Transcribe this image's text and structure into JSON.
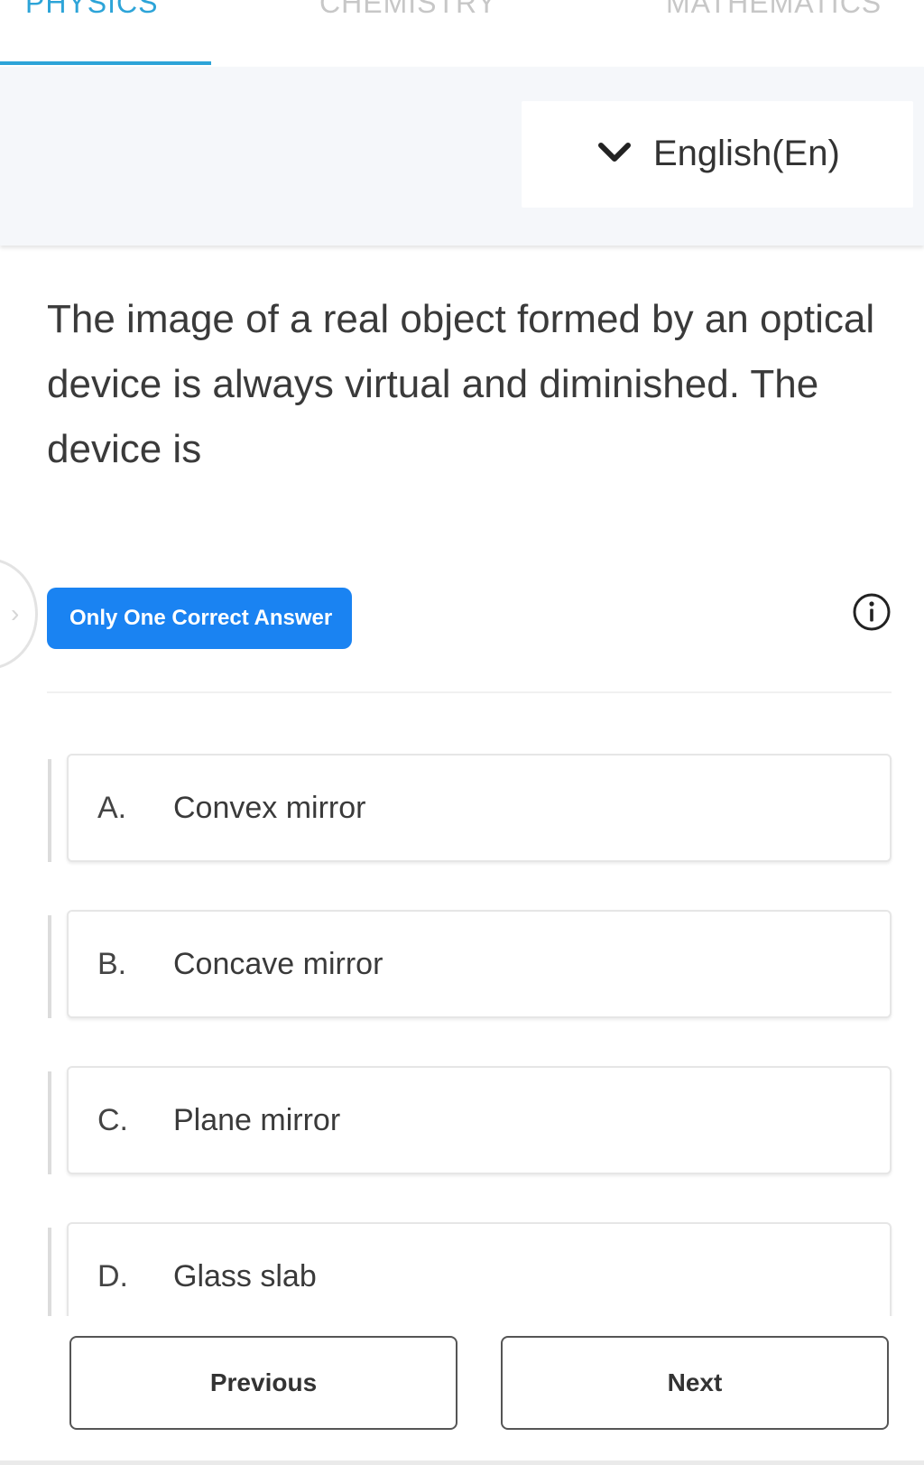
{
  "tabs": [
    {
      "label": "PHYSICS",
      "active": true
    },
    {
      "label": "CHEMISTRY",
      "active": false
    },
    {
      "label": "MATHEMATICS",
      "active": false
    }
  ],
  "language": {
    "selected": "English(En)",
    "icon": "chevron-down-icon"
  },
  "question": {
    "text": "The image of a real object formed by an optical device is always virtual and diminished. The device is"
  },
  "answer_type": {
    "label": "Only One Correct Answer",
    "info_icon": "info-icon"
  },
  "options": [
    {
      "letter": "A.",
      "text": "Convex mirror"
    },
    {
      "letter": "B.",
      "text": "Concave mirror"
    },
    {
      "letter": "C.",
      "text": "Plane mirror"
    },
    {
      "letter": "D.",
      "text": "Glass slab"
    }
  ],
  "navigation": {
    "previous_label": "Previous",
    "next_label": "Next"
  },
  "colors": {
    "accent": "#2da4d8",
    "badge": "#1a83f2"
  }
}
